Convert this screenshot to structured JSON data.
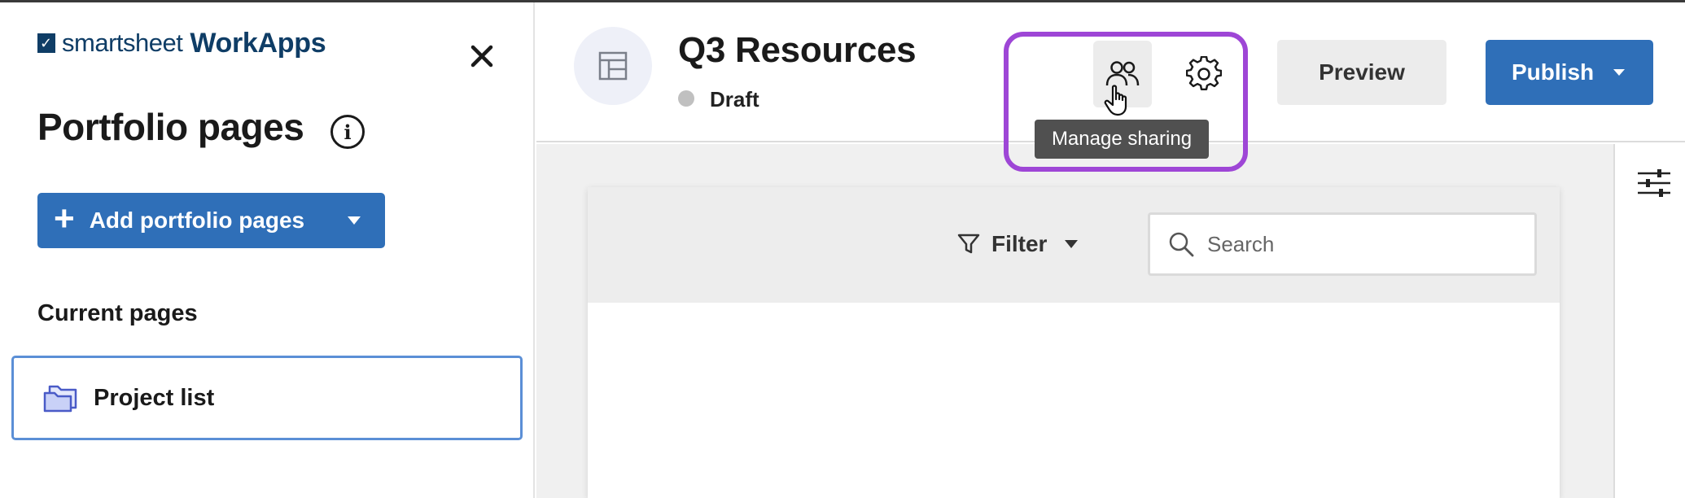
{
  "sidebar": {
    "logo_brand": "smartsheet",
    "logo_product": "WorkApps",
    "title": "Portfolio pages",
    "add_button_label": "Add portfolio pages",
    "current_pages_label": "Current pages",
    "pages": [
      {
        "label": "Project list"
      }
    ]
  },
  "header": {
    "page_title": "Q3 Resources",
    "status": "Draft",
    "tooltip": "Manage sharing",
    "preview_label": "Preview",
    "publish_label": "Publish"
  },
  "toolbar": {
    "filter_label": "Filter",
    "search_placeholder": "Search",
    "search_value": ""
  },
  "colors": {
    "primary": "#2f6fb8",
    "highlight": "#9e46d6",
    "selected_border": "#5b8fd6",
    "brand_navy": "#0f3d66",
    "status_draft": "#c0c0c0"
  },
  "icons": {
    "close": "close-icon",
    "info": "info-icon",
    "add": "plus-icon",
    "folder": "folder-icon",
    "page_thumb": "layout-icon",
    "sharing": "people-icon",
    "settings": "gear-icon",
    "filter": "funnel-icon",
    "search": "search-icon",
    "sliders": "sliders-icon"
  }
}
